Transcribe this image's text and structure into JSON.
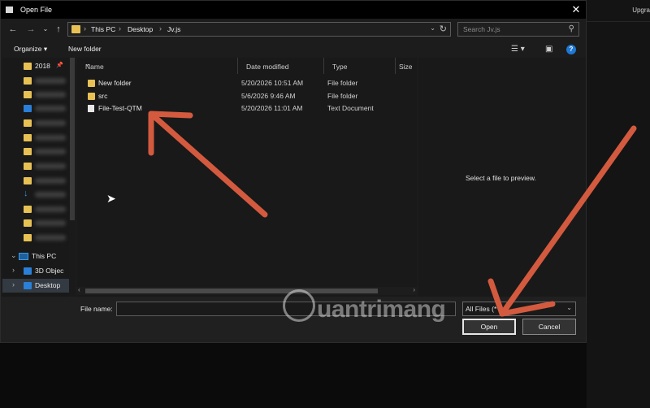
{
  "background_app": {
    "upgrade_label": "Upgra"
  },
  "dialog": {
    "title": "Open File",
    "close_glyph": "✕"
  },
  "breadcrumb": [
    "This PC",
    "Desktop",
    "Jv.js"
  ],
  "search": {
    "placeholder": "Search Jv.js"
  },
  "toolbar": {
    "organize": "Organize ▾",
    "new_folder": "New folder"
  },
  "sidebar": {
    "quick_access_label": "2018",
    "this_pc": "This PC",
    "objects_3d": "3D Objec",
    "desktop": "Desktop"
  },
  "columns": {
    "name": "Name",
    "date": "Date modified",
    "type": "Type",
    "size": "Size"
  },
  "files": [
    {
      "name": "New folder",
      "date": "5/20/2026 10:51 AM",
      "type": "File folder",
      "icon": "folder-icon"
    },
    {
      "name": "src",
      "date": "5/6/2026 9:46 AM",
      "type": "File folder",
      "icon": "folder-icon"
    },
    {
      "name": "File-Test-QTM",
      "date": "5/20/2026 11:01 AM",
      "type": "Text Document",
      "icon": "text-file-icon"
    }
  ],
  "preview": {
    "message": "Select a file to preview."
  },
  "bottom": {
    "file_name_label": "File name:",
    "file_name_value": "",
    "filter_value": "All Files (*",
    "open_label": "Open",
    "cancel_label": "Cancel"
  },
  "watermark": {
    "text": "uantrimang"
  },
  "colors": {
    "arrow": "#d35a3e",
    "folder": "#e8c155",
    "accent": "#1e78d4"
  }
}
